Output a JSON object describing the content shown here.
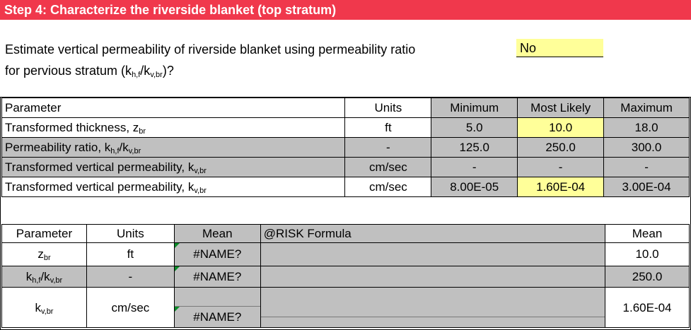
{
  "header": {
    "title": "Step 4: Characterize the riverside blanket (top stratum)"
  },
  "question": {
    "line1": "Estimate vertical permeability of riverside blanket using permeability ratio",
    "line2_prefix": "for pervious stratum (k",
    "line2_sub1": "h,f",
    "line2_mid": "/k",
    "line2_sub2": "v,br",
    "line2_suffix": ")?",
    "answer": "No"
  },
  "table1": {
    "headers": [
      "Parameter",
      "Units",
      "Minimum",
      "Most Likely",
      "Maximum"
    ],
    "rows": [
      {
        "param": "Transformed thickness, z",
        "param_sub": "br",
        "param_mid": "",
        "param_sub2": "",
        "units": "ft",
        "min": "5.0",
        "likely": "10.0",
        "max": "18.0"
      },
      {
        "param": "Permeability ratio, k",
        "param_sub": "h,f",
        "param_mid": "/k",
        "param_sub2": "v,br",
        "units": "-",
        "min": "125.0",
        "likely": "250.0",
        "max": "300.0"
      },
      {
        "param": "Transformed vertical permeability, k",
        "param_sub": "v,br",
        "param_mid": "",
        "param_sub2": "",
        "units": "cm/sec",
        "min": "-",
        "likely": "-",
        "max": "-"
      },
      {
        "param": "Transformed vertical permeability, k",
        "param_sub": "v,br",
        "param_mid": "",
        "param_sub2": "",
        "units": "cm/sec",
        "min": "8.00E-05",
        "likely": "1.60E-04",
        "max": "3.00E-04"
      }
    ]
  },
  "table2": {
    "headers": {
      "parameter": "Parameter",
      "units": "Units",
      "mean": "Mean",
      "formula": "@RISK Formula",
      "mean2": "Mean"
    },
    "rows": [
      {
        "p": "z",
        "p_sub": "br",
        "p_mid": "",
        "p_sub2": "",
        "units": "ft",
        "mean": "#NAME?",
        "mean2": "10.0"
      },
      {
        "p": "k",
        "p_sub": "h,f",
        "p_mid": "/k",
        "p_sub2": "v,br",
        "units": "-",
        "mean": "#NAME?",
        "mean2": "250.0"
      },
      {
        "p": "k",
        "p_sub": "v,br",
        "p_mid": "",
        "p_sub2": "",
        "units": "cm/sec",
        "mean": "#NAME?",
        "mean2": "1.60E-04"
      }
    ]
  },
  "colors": {
    "banner": "#f0384c",
    "input_yellow": "#ffff99",
    "grey": "#c0c0c0",
    "error_marker": "#0a8a28"
  }
}
